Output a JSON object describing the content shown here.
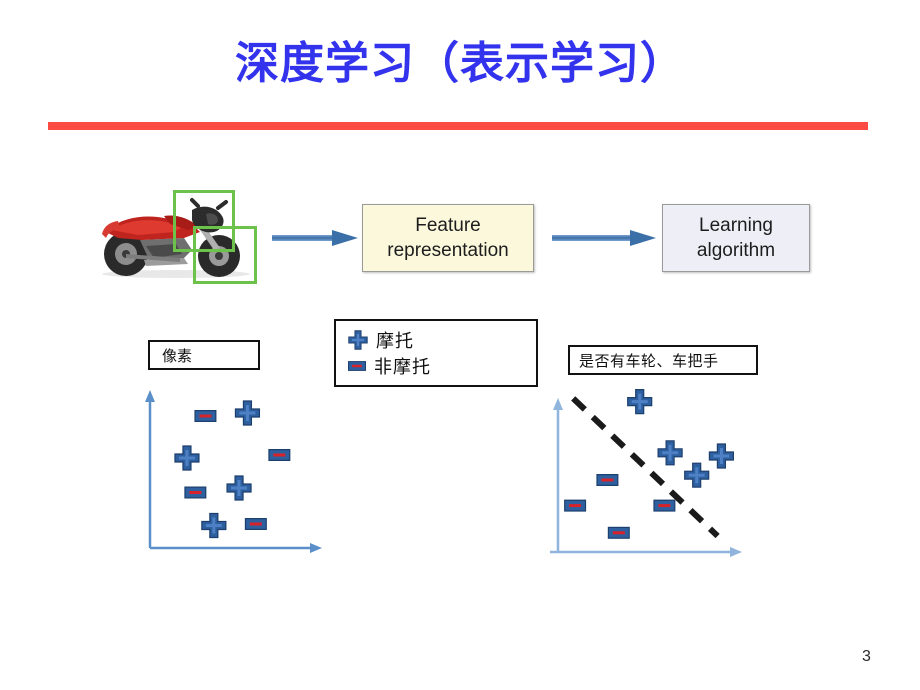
{
  "slide": {
    "title": "深度学习（表示学习）",
    "title_color": "#3333ee",
    "rule_color": "#fb4b42",
    "page_number": "3",
    "background": "#ffffff"
  },
  "pipeline": {
    "image_alt": "motorcycle-photo",
    "highlight_boxes": [
      {
        "name": "handlebar",
        "color": "#6cc24a"
      },
      {
        "name": "front-wheel",
        "color": "#6cc24a"
      }
    ],
    "arrow_color": "#4a7ebb",
    "boxes": [
      {
        "label": "Feature\nrepresentation",
        "line1": "Feature",
        "line2": "representation",
        "fill": "#fbf8dc"
      },
      {
        "label": "Learning\nalgorithm",
        "line1": "Learning",
        "line2": "algorithm",
        "fill": "#eeeef7"
      }
    ]
  },
  "legend": {
    "items": [
      {
        "marker": "plus-marker",
        "label": "摩托"
      },
      {
        "marker": "dash-marker",
        "label": "非摩托"
      }
    ],
    "marker_blue": "#2e5f9e",
    "marker_red": "#d8232a"
  },
  "captions": {
    "left": "像素",
    "right": "是否有车轮、车把手"
  },
  "chart_data": [
    {
      "type": "scatter",
      "title": "像素",
      "xlabel": "",
      "ylabel": "",
      "xlim": [
        0,
        100
      ],
      "ylim": [
        0,
        100
      ],
      "grid": false,
      "separator": null,
      "legend_position": "above",
      "series": [
        {
          "name": "摩托",
          "marker": "plus-marker",
          "color": "#2e5f9e",
          "points": [
            [
              58,
              90
            ],
            [
              22,
              60
            ],
            [
              53,
              40
            ],
            [
              38,
              15
            ]
          ]
        },
        {
          "name": "非摩托",
          "marker": "dash-marker",
          "color": "#d8232a",
          "points": [
            [
              33,
              88
            ],
            [
              77,
              62
            ],
            [
              27,
              37
            ],
            [
              63,
              16
            ]
          ]
        }
      ]
    },
    {
      "type": "scatter",
      "title": "是否有车轮、车把手",
      "xlabel": "",
      "ylabel": "",
      "xlim": [
        0,
        100
      ],
      "ylim": [
        0,
        100
      ],
      "grid": false,
      "separator": {
        "type": "dashed-line",
        "color": "#1a1a1a",
        "from": [
          8,
          96
        ],
        "to": [
          84,
          10
        ]
      },
      "legend_position": "above",
      "series": [
        {
          "name": "摩托",
          "marker": "plus-marker",
          "color": "#2e5f9e",
          "points": [
            [
              43,
              94
            ],
            [
              59,
              62
            ],
            [
              73,
              48
            ],
            [
              86,
              60
            ]
          ]
        },
        {
          "name": "非摩托",
          "marker": "dash-marker",
          "color": "#d8232a",
          "points": [
            [
              26,
              45
            ],
            [
              9,
              29
            ],
            [
              56,
              29
            ],
            [
              32,
              12
            ]
          ]
        }
      ]
    }
  ]
}
